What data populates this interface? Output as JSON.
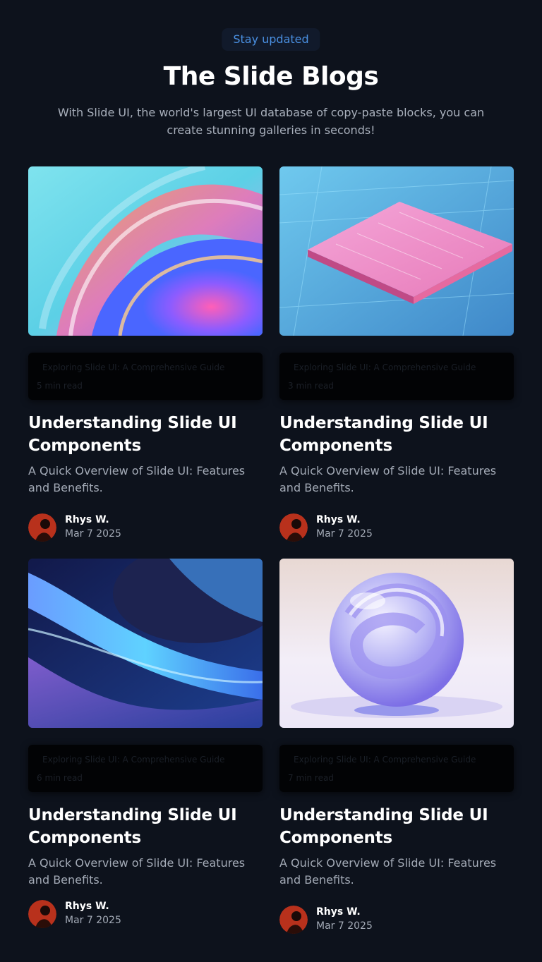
{
  "header": {
    "badge": "Stay updated",
    "title": "The Slide Blogs",
    "subtitle": "With Slide UI, the world's largest UI database of copy-paste blocks, you can create stunning galleries in seconds!"
  },
  "posts": [
    {
      "image": "abstract-glass-swirl-image",
      "guide": "Exploring Slide UI: A Comprehensive Guide",
      "read_time": "5 min read",
      "title": "Understanding Slide UI Components",
      "description": "A Quick Overview of Slide UI: Features and Benefits.",
      "author": "Rhys W.",
      "date": "Mar 7 2025"
    },
    {
      "image": "circuit-chip-image",
      "guide": "Exploring Slide UI: A Comprehensive Guide",
      "read_time": "3 min read",
      "title": "Understanding Slide UI Components",
      "description": "A Quick Overview of Slide UI: Features and Benefits.",
      "author": "Rhys W.",
      "date": "Mar 7 2025"
    },
    {
      "image": "blue-wave-ribbon-image",
      "guide": "Exploring Slide UI: A Comprehensive Guide",
      "read_time": "6 min read",
      "title": "Understanding Slide UI Components",
      "description": "A Quick Overview of Slide UI: Features and Benefits.",
      "author": "Rhys W.",
      "date": "Mar 7 2025"
    },
    {
      "image": "glass-sphere-image",
      "guide": "Exploring Slide UI: A Comprehensive Guide",
      "read_time": "7 min read",
      "title": "Understanding Slide UI Components",
      "description": "A Quick Overview of Slide UI: Features and Benefits.",
      "author": "Rhys W.",
      "date": "Mar 7 2025"
    }
  ],
  "colors": {
    "background": "#0d121c",
    "badge_text": "#4a90e2",
    "muted_text": "#a3aab6"
  }
}
